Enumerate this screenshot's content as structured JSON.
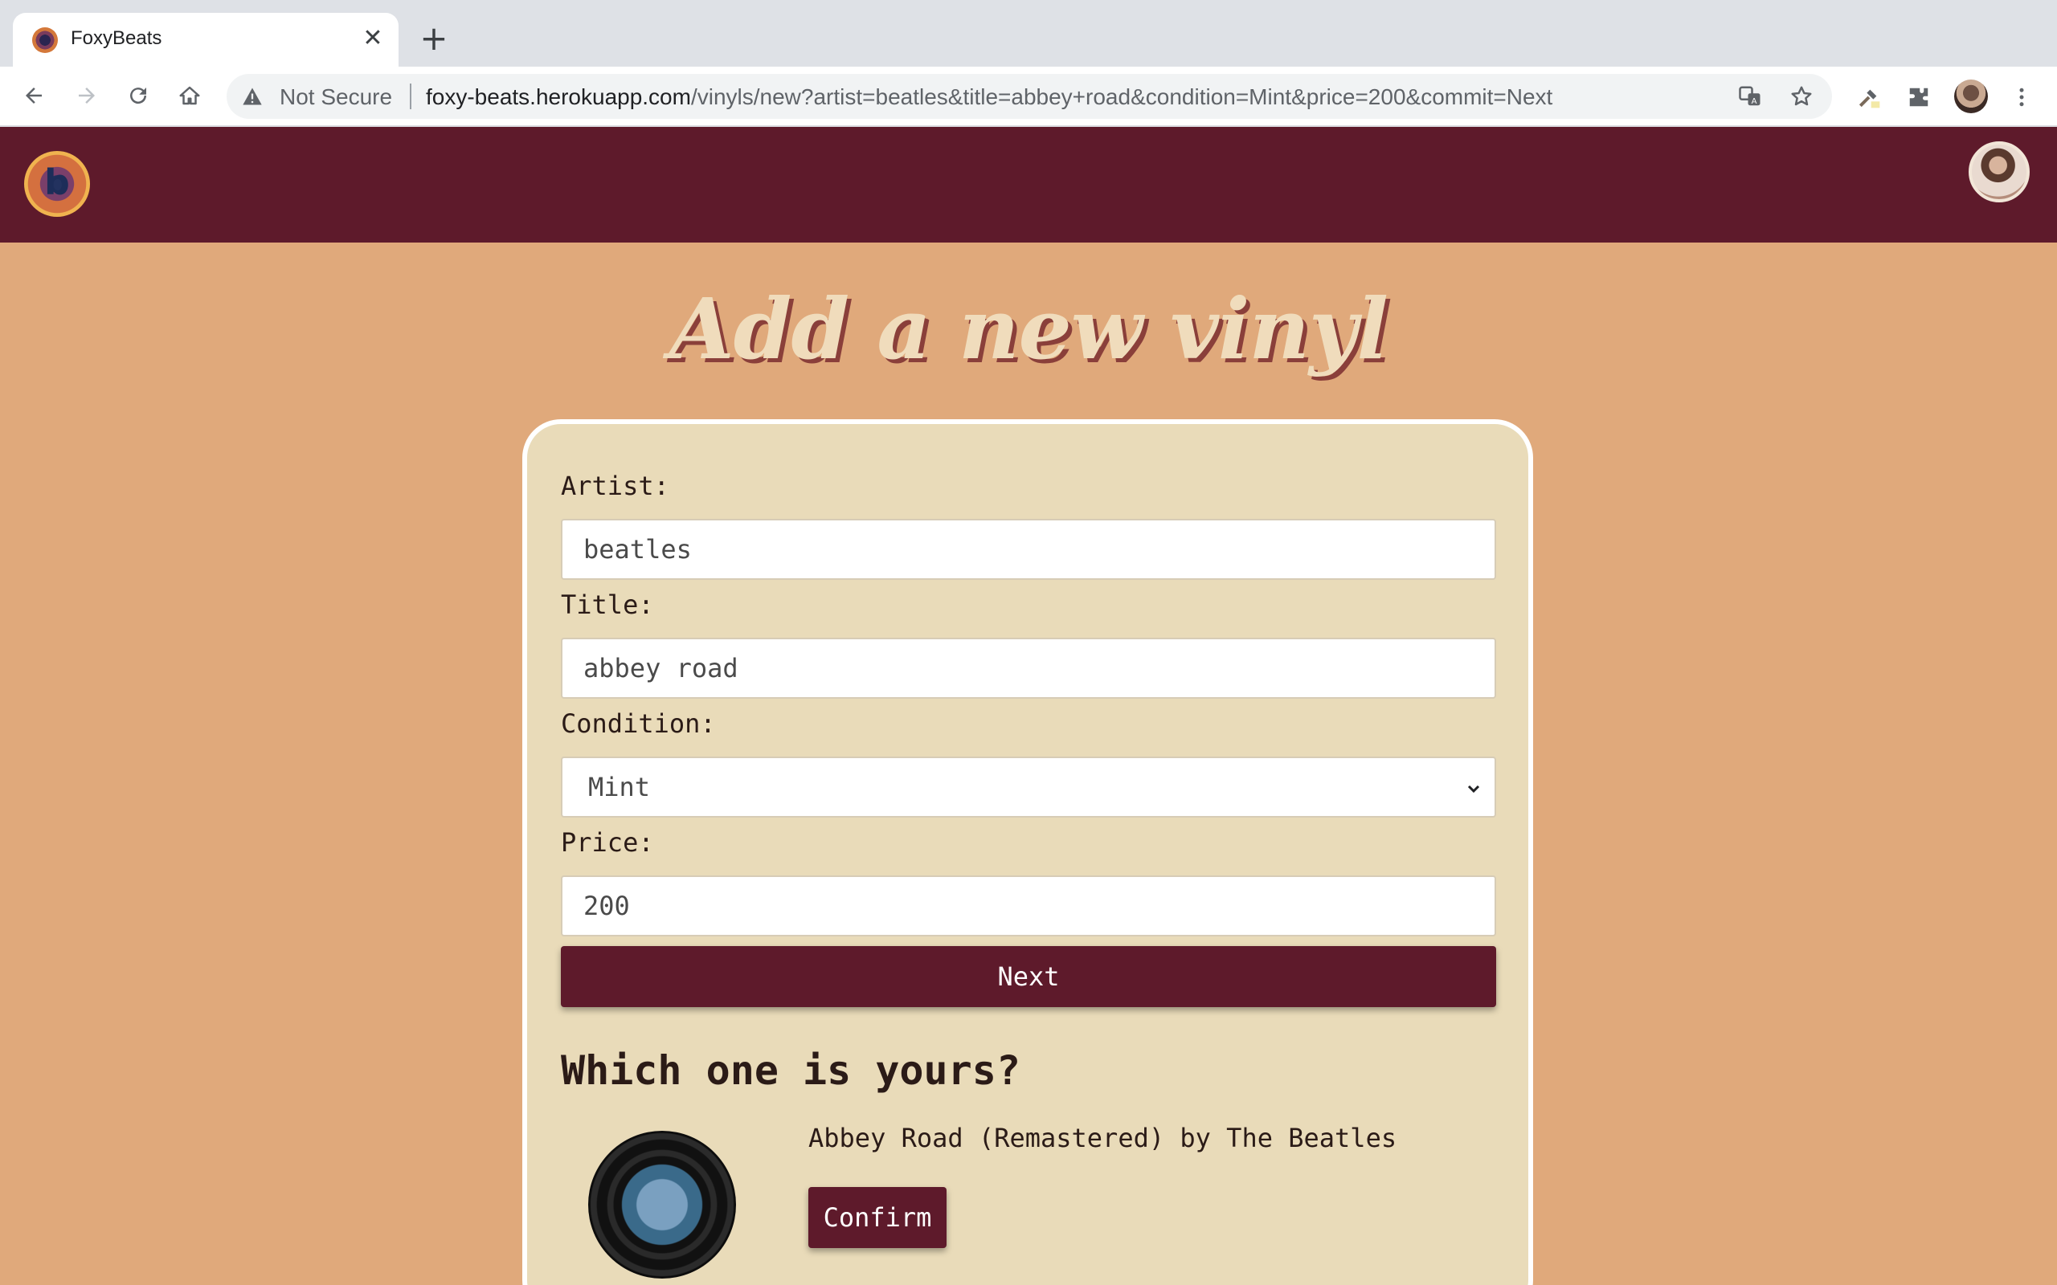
{
  "browser": {
    "tab_title": "FoxyBeats",
    "tab_close": "✕",
    "new_tab": "+",
    "security_label": "Not Secure",
    "url_host": "foxy-beats.herokuapp.com",
    "url_path": "/vinyls/new?artist=beatles&title=abbey+road&condition=Mint&price=200&commit=Next"
  },
  "form": {
    "page_title": "Add a new vinyl",
    "artist_label": "Artist:",
    "artist_value": "beatles",
    "title_label": "Title:",
    "title_value": "abbey road",
    "condition_label": "Condition:",
    "condition_value": "Mint",
    "price_label": "Price:",
    "price_value": "200",
    "next_label": "Next"
  },
  "results": {
    "heading": "Which one is yours?",
    "items": [
      {
        "description": "Abbey Road (Remastered) by The Beatles",
        "confirm_label": "Confirm"
      }
    ]
  },
  "colors": {
    "header_bg": "#5e1a2b",
    "page_bg": "#e0a97b",
    "card_bg": "#e9dbb9",
    "button_bg": "#5e1a2b",
    "title_color": "#f0dcbc"
  },
  "icons": [
    "back-icon",
    "forward-icon",
    "reload-icon",
    "home-icon",
    "warning-icon",
    "translate-icon",
    "star-icon",
    "eyedropper-icon",
    "puzzle-icon",
    "kebab-menu-icon",
    "chevron-down-icon"
  ]
}
